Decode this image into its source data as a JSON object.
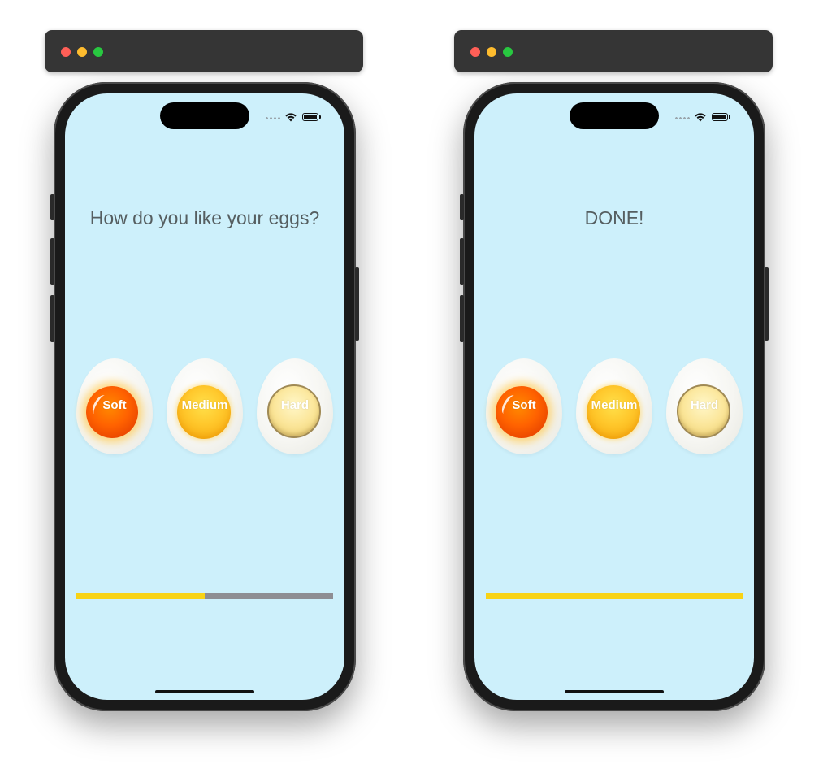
{
  "simulators": [
    {
      "title_label": "How do you like your eggs?",
      "eggs": [
        {
          "label": "Soft"
        },
        {
          "label": "Medium"
        },
        {
          "label": "Hard"
        }
      ],
      "progress": 0.5,
      "progress_colors": {
        "fill": "#f8d316",
        "track": "#8e8e93"
      }
    },
    {
      "title_label": "DONE!",
      "eggs": [
        {
          "label": "Soft"
        },
        {
          "label": "Medium"
        },
        {
          "label": "Hard"
        }
      ],
      "progress": 1.0,
      "progress_colors": {
        "fill": "#f8d316",
        "track": "#8e8e93"
      }
    }
  ],
  "window_controls": {
    "close_color": "#ff5f57",
    "minimize_color": "#febc2e",
    "zoom_color": "#28c840"
  },
  "theme": {
    "screen_background": "#cdf0fb"
  }
}
